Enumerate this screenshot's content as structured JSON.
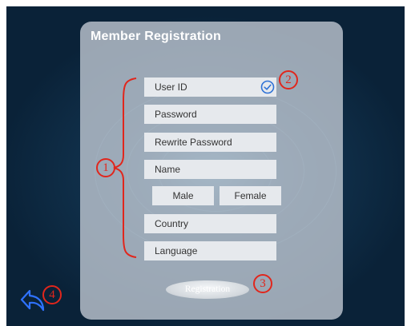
{
  "panel": {
    "title": "Member Registration"
  },
  "form": {
    "user_id": "User ID",
    "password": "Password",
    "rewrite_password": "Rewrite Password",
    "name": "Name",
    "male": "Male",
    "female": "Female",
    "country": "Country",
    "language": "Language",
    "register_label": "Registration"
  },
  "annotations": {
    "a1": "1",
    "a2": "2",
    "a3": "3",
    "a4": "4"
  },
  "icons": {
    "check": "check-circle-icon",
    "back": "back-arrow-icon"
  },
  "colors": {
    "annotation_red": "#e1261c",
    "accent_blue": "#2f72d6",
    "back_arrow_blue": "#2f72ff"
  }
}
